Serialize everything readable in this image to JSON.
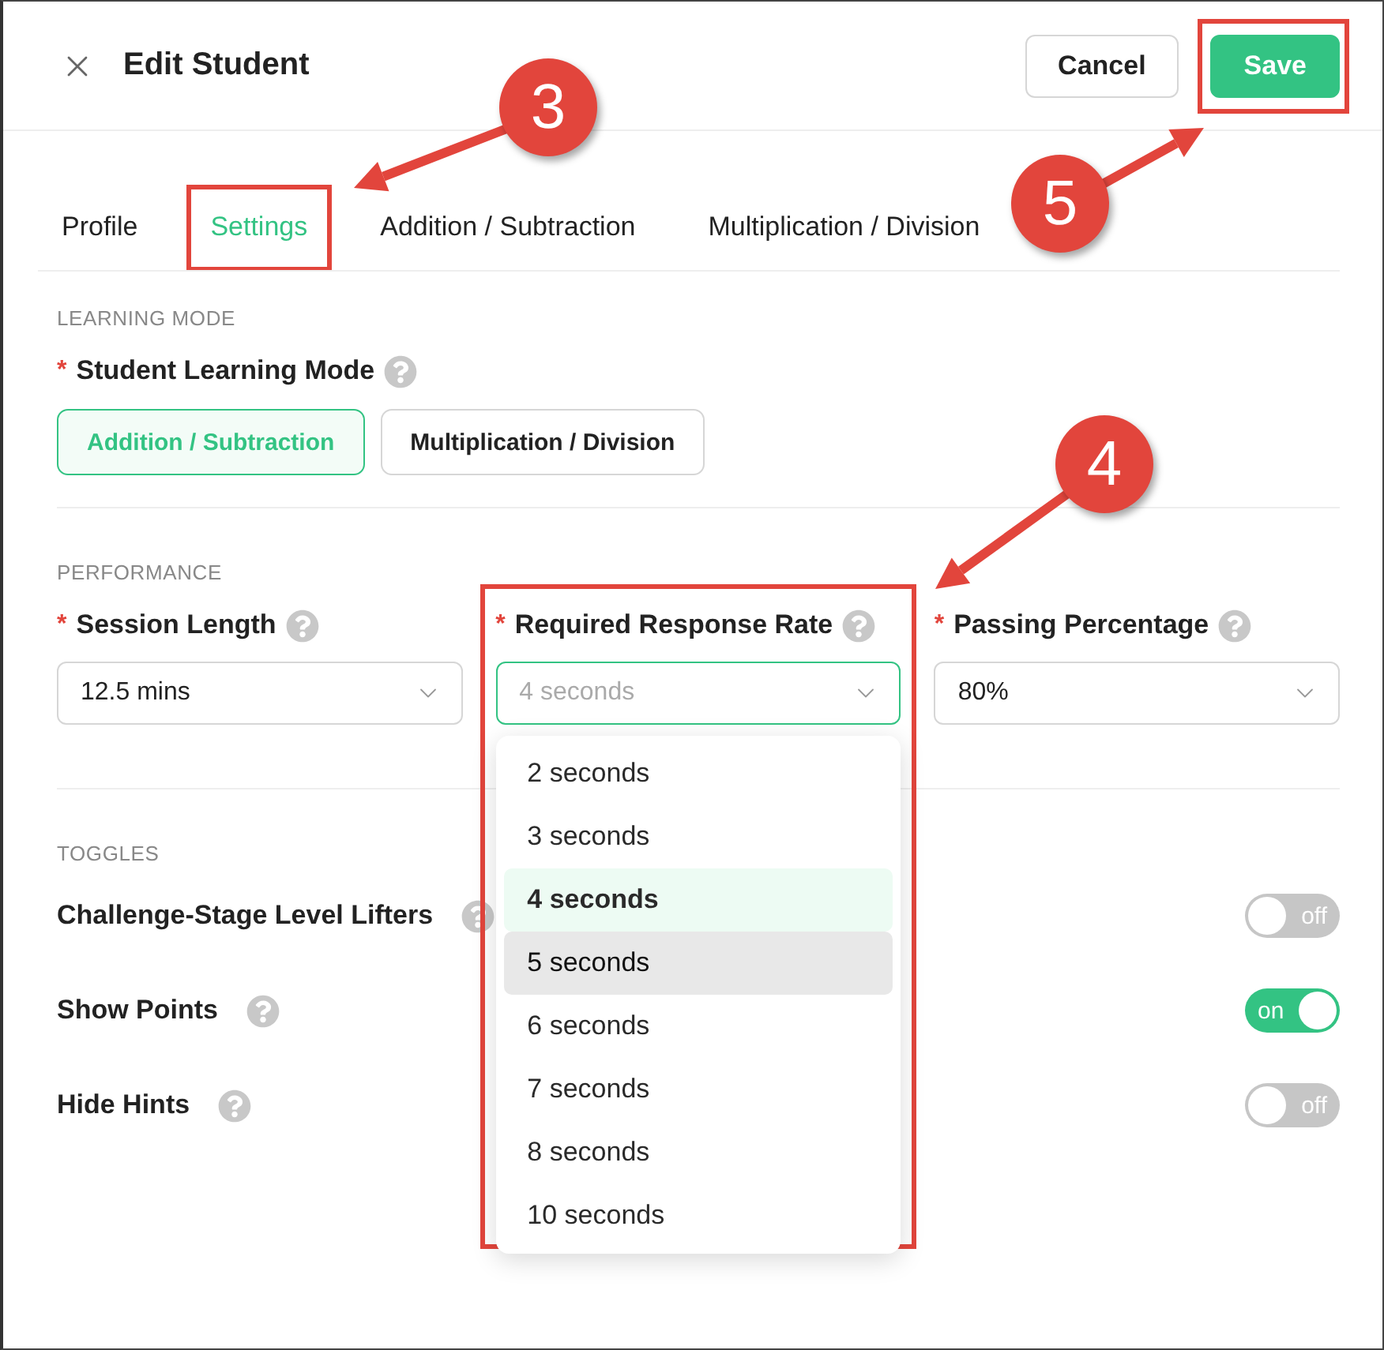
{
  "header": {
    "title": "Edit Student",
    "cancel": "Cancel",
    "save": {
      "label": "Save",
      "highlighted": true
    }
  },
  "tabs": [
    {
      "label": "Profile",
      "selected": false,
      "highlighted": false
    },
    {
      "label": "Settings",
      "selected": true,
      "highlighted": true
    },
    {
      "label": "Addition / Subtraction",
      "selected": false,
      "highlighted": false
    },
    {
      "label": "Multiplication / Division",
      "selected": false,
      "highlighted": false
    }
  ],
  "learning_mode": {
    "section": "LEARNING MODE",
    "label": "Student Learning Mode",
    "required_mark": "*",
    "options": [
      {
        "label": "Addition / Subtraction",
        "selected": true
      },
      {
        "label": "Multiplication / Division",
        "selected": false
      }
    ]
  },
  "performance": {
    "section": "PERFORMANCE",
    "fields": [
      {
        "label": "Session Length",
        "required_mark": "*",
        "value": "12.5 mins",
        "open": false
      },
      {
        "label": "Required Response Rate",
        "required_mark": "*",
        "value": "4 seconds",
        "open": true,
        "highlighted": true,
        "options": [
          {
            "label": "2 seconds",
            "selected": false,
            "hovered": false
          },
          {
            "label": "3 seconds",
            "selected": false,
            "hovered": false
          },
          {
            "label": "4 seconds",
            "selected": true,
            "hovered": false
          },
          {
            "label": "5 seconds",
            "selected": false,
            "hovered": true
          },
          {
            "label": "6 seconds",
            "selected": false,
            "hovered": false
          },
          {
            "label": "7 seconds",
            "selected": false,
            "hovered": false
          },
          {
            "label": "8 seconds",
            "selected": false,
            "hovered": false
          },
          {
            "label": "10 seconds",
            "selected": false,
            "hovered": false
          }
        ]
      },
      {
        "label": "Passing Percentage",
        "required_mark": "*",
        "value": "80%",
        "open": false
      }
    ]
  },
  "toggles": {
    "section": "TOGGLES",
    "items": [
      {
        "label": "Challenge-Stage Level Lifters",
        "on": false,
        "state_text": "off"
      },
      {
        "label": "Show Points",
        "on": true,
        "state_text": "on"
      },
      {
        "label": "Hide Hints",
        "on": false,
        "state_text": "off"
      }
    ]
  },
  "callouts": [
    {
      "number": "3"
    },
    {
      "number": "4"
    },
    {
      "number": "5"
    }
  ]
}
